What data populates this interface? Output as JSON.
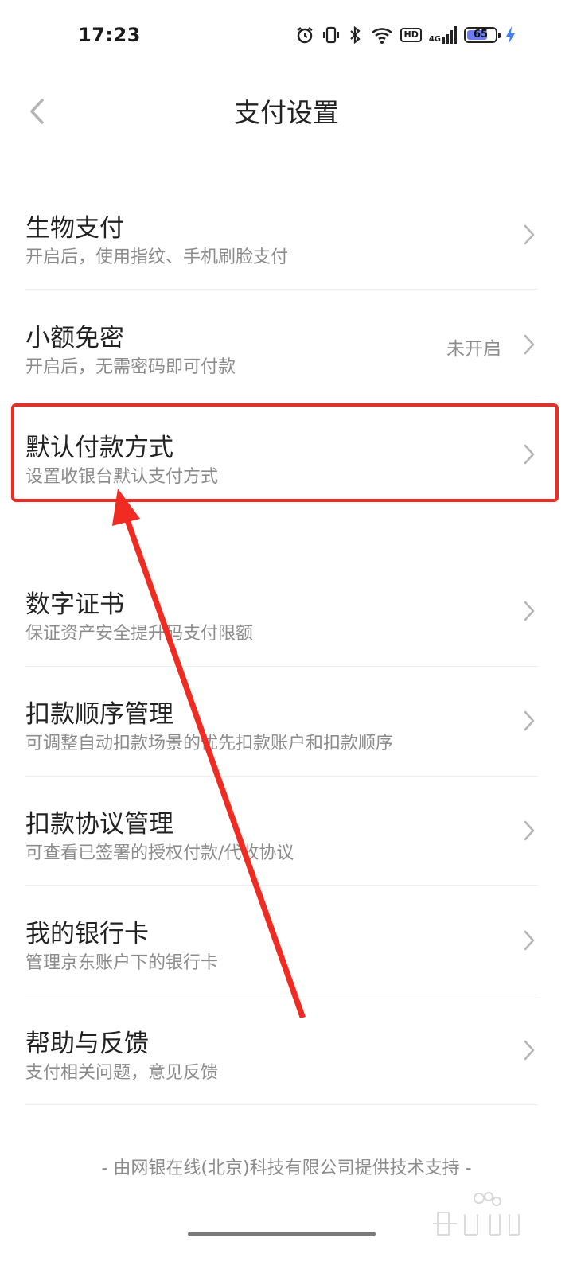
{
  "status_bar": {
    "time": "17:23",
    "network": "4G",
    "hd": "HD",
    "battery": "65"
  },
  "nav": {
    "title": "支付设置"
  },
  "items": [
    {
      "title": "生物支付",
      "subtitle": "开启后，使用指纹、手机刷脸支付",
      "status": ""
    },
    {
      "title": "小额免密",
      "subtitle": "开启后，无需密码即可付款",
      "status": "未开启"
    },
    {
      "title": "默认付款方式",
      "subtitle": "设置收银台默认支付方式",
      "status": ""
    },
    {
      "title": "数字证书",
      "subtitle": "保证资产安全提升码支付限额",
      "status": ""
    },
    {
      "title": "扣款顺序管理",
      "subtitle": "可调整自动扣款场景的优先扣款账户和扣款顺序",
      "status": ""
    },
    {
      "title": "扣款协议管理",
      "subtitle": "可查看已签署的授权付款/代收协议",
      "status": ""
    },
    {
      "title": "我的银行卡",
      "subtitle": "管理京东账户下的银行卡",
      "status": ""
    },
    {
      "title": "帮助与反馈",
      "subtitle": "支付相关问题，意见反馈",
      "status": ""
    }
  ],
  "footer": "- 由网银在线(北京)科技有限公司提供技术支持 -",
  "colors": {
    "highlight": "#f02b22",
    "arrow": "#f02b22",
    "battery_fill": "#6c7cf4"
  }
}
